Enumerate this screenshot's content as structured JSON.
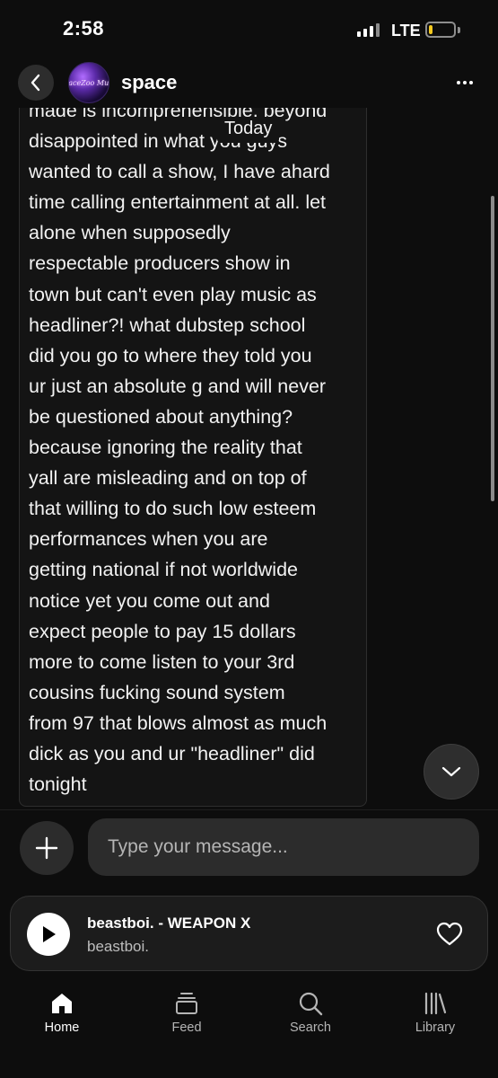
{
  "status_bar": {
    "time": "2:58",
    "network": "LTE",
    "battery_level": 0.15,
    "battery_color": "#f4c91f"
  },
  "header": {
    "title": "space",
    "back_icon": "chevron-left-icon",
    "more_icon": "more-horizontal-icon",
    "avatar_text": "SpaceZoo Music"
  },
  "conversation": {
    "date_label": "Today",
    "message_lines": [
      "made is incomprehensible. beyond",
      "disappointed in what you guys",
      "wanted to call a show, I have ahard",
      "time calling entertainment at all. let",
      "alone when supposedly",
      "respectable producers show in",
      "town but can't even play music as",
      "headliner?! what dubstep school",
      "did you go to where they told you",
      "ur just an absolute g and will never",
      "be questioned about anything?",
      "because ignoring the reality that",
      "yall are misleading and on top of",
      "that willing to do such low esteem",
      "performances when you are",
      "getting national if not worldwide",
      "notice yet you come out and",
      "expect people to pay 15 dollars",
      "more to come listen to your 3rd",
      "cousins fucking sound system",
      "from 97 that blows almost as much",
      "dick as you and ur \"headliner\" did",
      "tonight"
    ],
    "scroll_down_icon": "chevron-down-icon"
  },
  "composer": {
    "placeholder": "Type your message...",
    "value": "",
    "add_icon": "plus-icon"
  },
  "player": {
    "title": "beastboi. - WEAPON X",
    "artist": "beastboi.",
    "play_icon": "play-icon",
    "like_icon": "heart-icon"
  },
  "tabs": [
    {
      "label": "Home",
      "icon": "home-icon",
      "active": true
    },
    {
      "label": "Feed",
      "icon": "feed-icon",
      "active": false
    },
    {
      "label": "Search",
      "icon": "search-icon",
      "active": false
    },
    {
      "label": "Library",
      "icon": "library-icon",
      "active": false
    }
  ]
}
